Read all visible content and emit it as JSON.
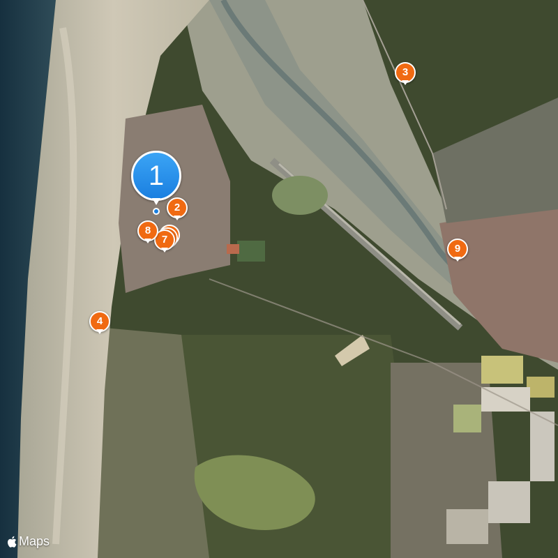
{
  "map": {
    "kind": "satellite",
    "pins": [
      {
        "label": "1",
        "selected": true
      },
      {
        "label": "2"
      },
      {
        "label": "3"
      },
      {
        "label": "4"
      },
      {
        "label": "7"
      },
      {
        "label": "8"
      },
      {
        "label": "9"
      }
    ],
    "attribution": "Maps",
    "colors": {
      "pin": "#f06a12",
      "selected_pin": "#1a7fe0",
      "sea": "#1d3a4c",
      "sand": "#cfc6b4",
      "forest": "#3a4a2c",
      "town": "#8a7a70",
      "farmland": "#c8c27a"
    }
  }
}
